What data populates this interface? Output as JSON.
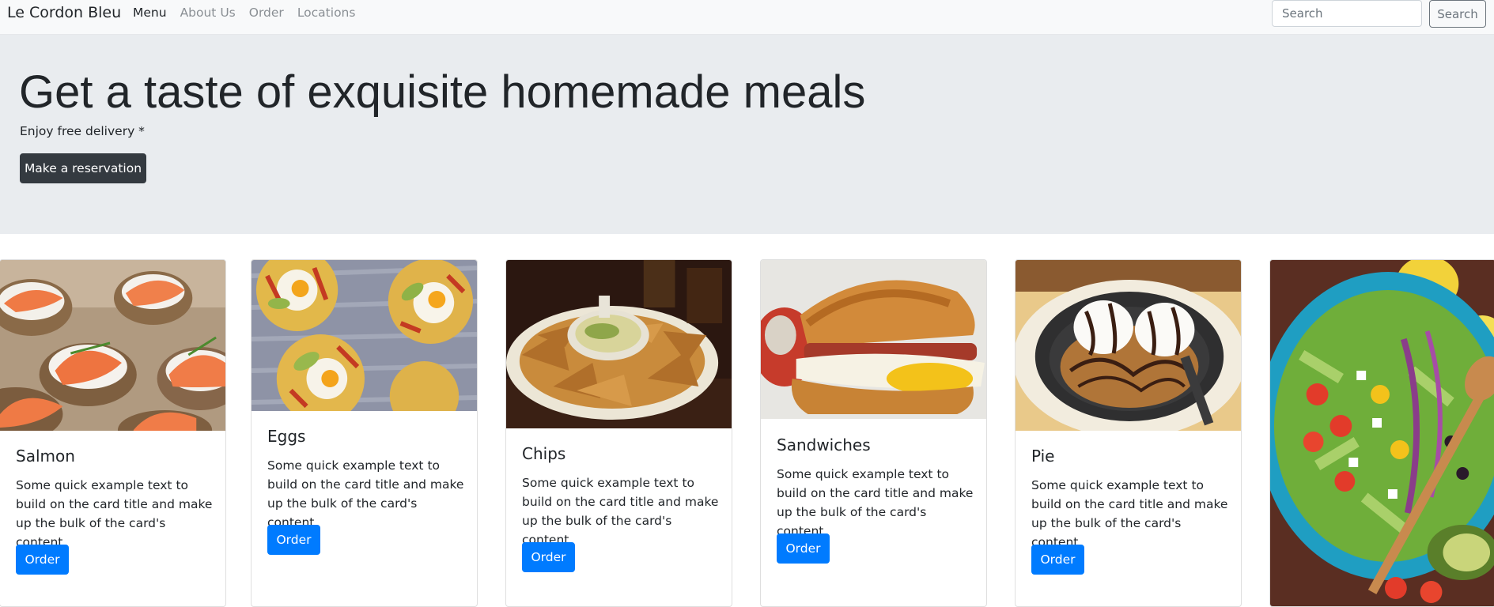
{
  "navbar": {
    "brand": "Le Cordon Bleu",
    "links": [
      "Menu",
      "About Us",
      "Order",
      "Locations"
    ],
    "search_placeholder": "Search",
    "search_button": "Search"
  },
  "hero": {
    "title": "Get a taste of exquisite homemade meals",
    "subtitle": "Enjoy free delivery *",
    "button": "Make a reservation"
  },
  "cards": [
    {
      "title": "Salmon",
      "text": "Some quick example text to build on the card title and make up the bulk of the card's content.",
      "button": "Order",
      "image": "salmon-canapes-image"
    },
    {
      "title": "Eggs",
      "text": "Some quick example text to build on the card title and make up the bulk of the card's content.",
      "button": "Order",
      "image": "egg-tostadas-image"
    },
    {
      "title": "Chips",
      "text": "Some quick example text to build on the card title and make up the bulk of the card's content.",
      "button": "Order",
      "image": "chips-and-dip-image"
    },
    {
      "title": "Sandwiches",
      "text": "Some quick example text to build on the card title and make up the bulk of the card's content.",
      "button": "Order",
      "image": "egg-sandwich-image"
    },
    {
      "title": "Pie",
      "text": "Some quick example text to build on the card title and make up the bulk of the card's content.",
      "button": "Order",
      "image": "cookie-skillet-image"
    },
    {
      "image": "salad-bowl-image"
    }
  ],
  "colors": {
    "navbar_bg": "#f8f9fa",
    "jumbotron_bg": "#e9ecef",
    "primary": "#007bff",
    "dark": "#343a40"
  }
}
